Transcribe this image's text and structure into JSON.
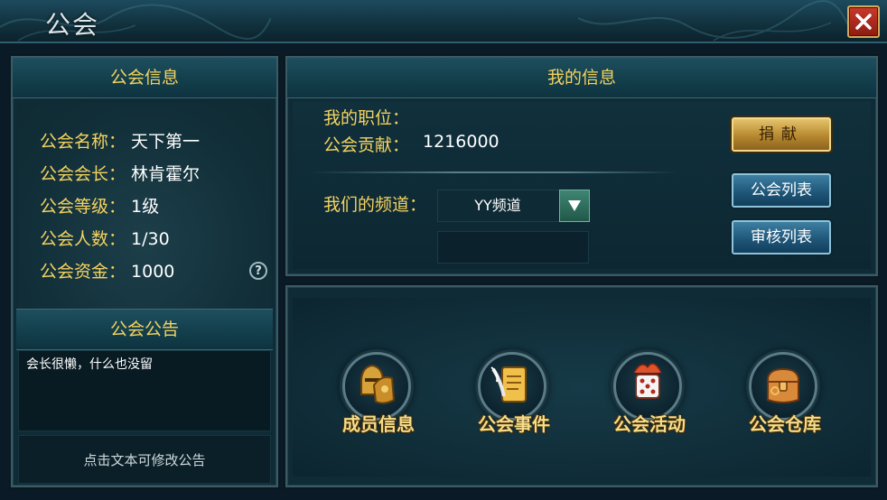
{
  "window": {
    "title": "公会",
    "close_icon": "close-icon"
  },
  "guild_info": {
    "header": "公会信息",
    "rows": [
      {
        "label": "公会名称：",
        "value": "天下第一"
      },
      {
        "label": "公会会长：",
        "value": "林肯霍尔"
      },
      {
        "label": "公会等级：",
        "value": "1级"
      },
      {
        "label": "公会人数：",
        "value": "1/30"
      },
      {
        "label": "公会资金：",
        "value": "1000"
      }
    ],
    "help_icon": "?"
  },
  "notice": {
    "header": "公会公告",
    "text": "会长很懒，什么也没留",
    "edit_hint": "点击文本可修改公告"
  },
  "my_info": {
    "header": "我的信息",
    "position_label": "我的职位：",
    "position_value": "",
    "contribution_label": "公会贡献：",
    "contribution_value": "1216000",
    "channel_label": "我们的频道：",
    "channel_value": "YY频道",
    "channel_input_value": "",
    "donate_button": "捐献",
    "guild_list_button": "公会列表",
    "review_list_button": "审核列表"
  },
  "functions": [
    {
      "label": "成员信息",
      "icon": "helmet-armor-icon"
    },
    {
      "label": "公会事件",
      "icon": "scroll-quill-icon"
    },
    {
      "label": "公会活动",
      "icon": "dice-icon"
    },
    {
      "label": "公会仓库",
      "icon": "treasure-bag-icon"
    }
  ],
  "colors": {
    "gold_text": "#f4d360",
    "panel_bg": "#0f2b36",
    "close_red": "#c83a2c",
    "button_teal": "#1f577a",
    "button_gold": "#b6892f"
  }
}
